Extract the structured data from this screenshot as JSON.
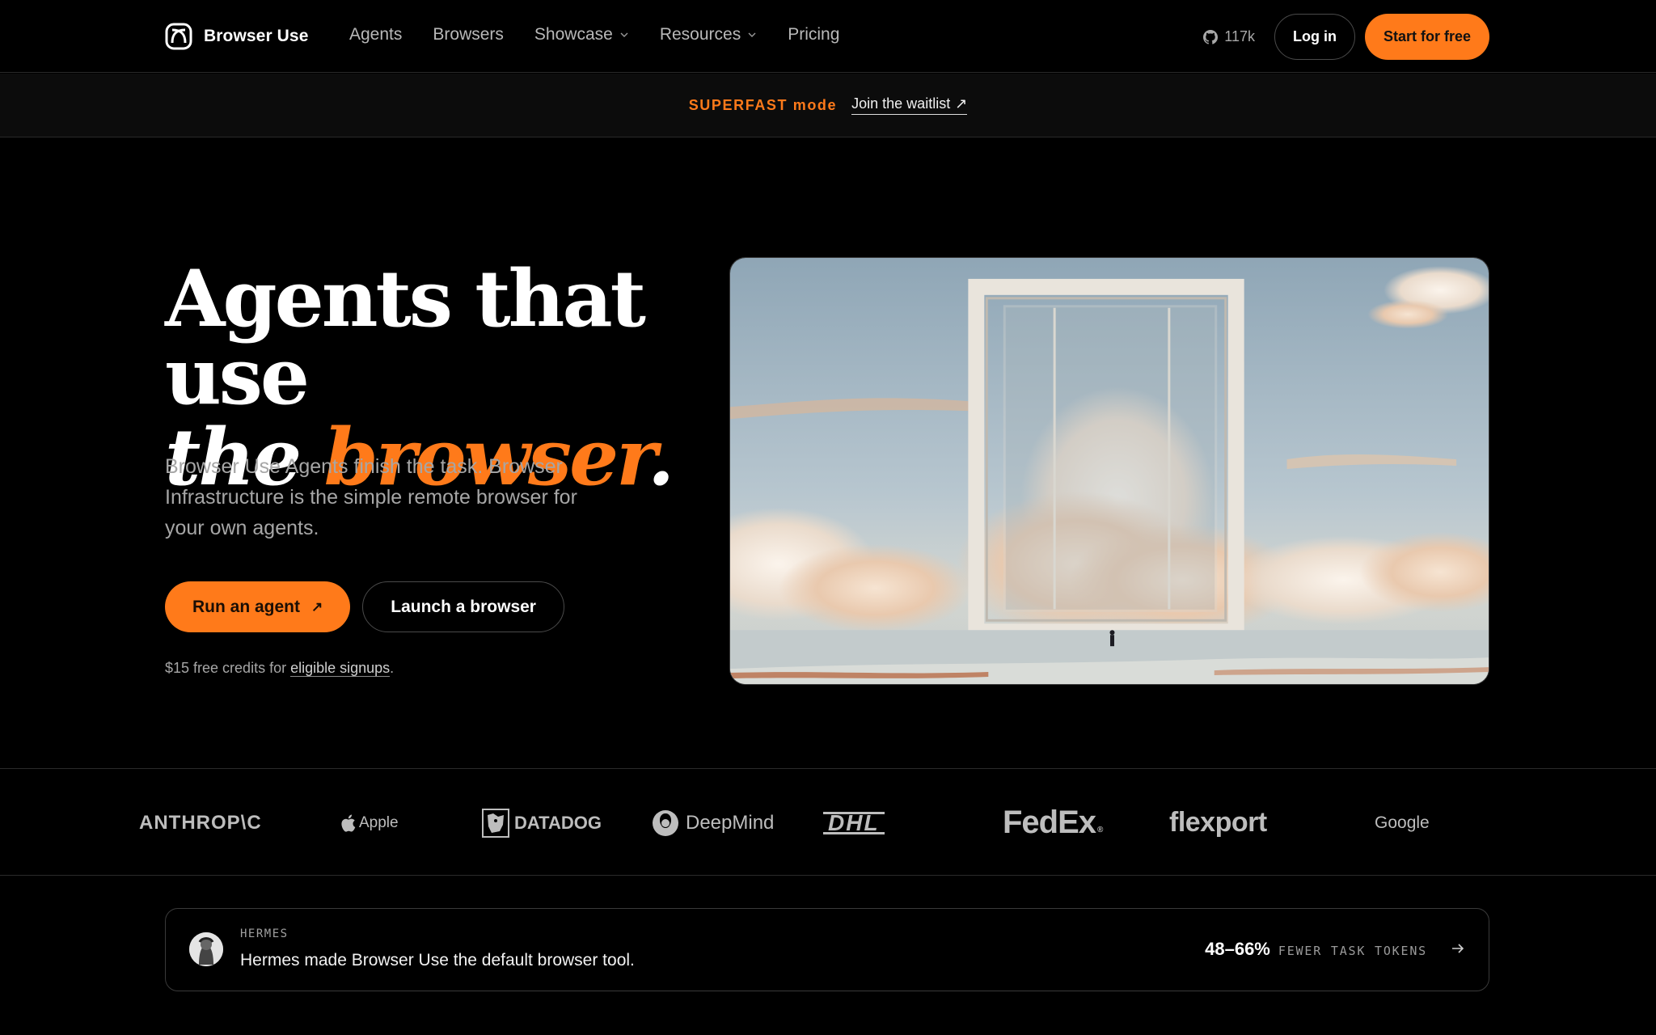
{
  "nav": {
    "brand": "Browser Use",
    "links": [
      {
        "label": "Agents",
        "dropdown": false
      },
      {
        "label": "Browsers",
        "dropdown": false
      },
      {
        "label": "Showcase",
        "dropdown": true
      },
      {
        "label": "Resources",
        "dropdown": true
      },
      {
        "label": "Pricing",
        "dropdown": false
      }
    ],
    "github_stars": "117k",
    "login_label": "Log in",
    "start_label": "Start for free"
  },
  "banner": {
    "tag": "SUPERFAST mode",
    "link_label": "Join the waitlist",
    "link_arrow": "↗"
  },
  "hero": {
    "title_line1": "Agents that use",
    "title_line2_a": "the ",
    "title_line2_accent": "browser",
    "title_line2_end": ".",
    "description": "Browser Use Agents finish the task. Browser Infrastructure is the simple remote browser for your own agents.",
    "primary_button": "Run an agent",
    "primary_arrow": "↗",
    "secondary_button": "Launch a browser",
    "credits_prefix": "$15 free credits for ",
    "credits_link": "eligible signups",
    "credits_suffix": "."
  },
  "logos": [
    "ANTHROP\\C",
    "Apple",
    "DATADOG",
    "DeepMind",
    "DHL",
    "FedEx",
    "flexport",
    "Google"
  ],
  "testimonial": {
    "kicker": "HERMES",
    "quote": "Hermes made Browser Use the default browser tool.",
    "stat_value": "48–66%",
    "stat_label": "FEWER TASK TOKENS"
  },
  "colors": {
    "accent": "#ff7a1a",
    "background": "#000000",
    "border": "#2a2a2a"
  }
}
